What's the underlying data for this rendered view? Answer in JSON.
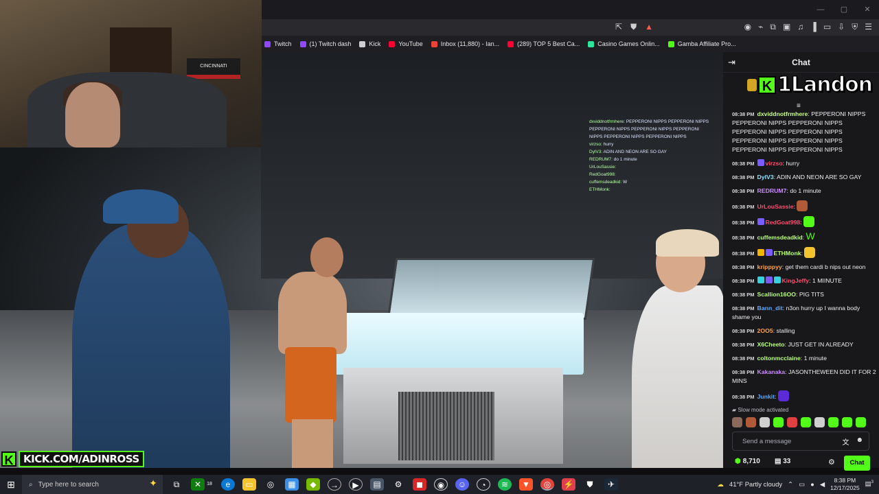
{
  "browser": {
    "bookmarks": [
      {
        "label": "Twitch",
        "color": "#9146ff"
      },
      {
        "label": "(1) Twitch dash",
        "color": "#9146ff"
      },
      {
        "label": "Kick",
        "color": "#cfcfcf"
      },
      {
        "label": "YouTube",
        "color": "#ff0033"
      },
      {
        "label": "Inbox (11,880) - Ian...",
        "color": "#ea4335"
      },
      {
        "label": "(289) TOP 5 Best Ca...",
        "color": "#ff0033"
      },
      {
        "label": "Casino Games Onlin...",
        "color": "#2ee59d"
      },
      {
        "label": "Gamba Affiliate Pro...",
        "color": "#53fc18"
      }
    ]
  },
  "stream": {
    "kick_url": "KICK.COM/ADINROSS",
    "webcam_flag": "CINCINNATI",
    "overlay_chat": [
      {
        "user": "dxviddnotfrmhere:",
        "text": "PEPPERONI NIPPS PEPPERONI NIPPS"
      },
      {
        "user": "",
        "text": "PEPPERONI NIPPS PEPPERONI NIPPS PEPPERONI"
      },
      {
        "user": "",
        "text": "NIPPS PEPPERONI NIPPS PEPPERONI NIPPS"
      },
      {
        "user": "virzso:",
        "text": "hurry"
      },
      {
        "user": "DylV3:",
        "text": "ADIN AND NEON ARE SO GAY"
      },
      {
        "user": "REDRUM7:",
        "text": "do 1 minute"
      },
      {
        "user": "UrLouSassie:",
        "text": ""
      },
      {
        "user": "RedGoat998:",
        "text": ""
      },
      {
        "user": "cuffemsdeadkid:",
        "text": "W"
      },
      {
        "user": "ETHMonk:",
        "text": ""
      }
    ]
  },
  "chat": {
    "title": "Chat",
    "pinned_banner": "1Landon",
    "messages": [
      {
        "time": "08:38 PM",
        "user": "dxviddnotfrmhere",
        "color": "#c9ff8a",
        "text": "PEPPERONI NIPPS PEPPERONI NIPPS PEPPERONI NIPPS PEPPERONI NIPPS PEPPERONI NIPPS PEPPERONI NIPPS PEPPERONI NIPPS PEPPERONI NIPPS PEPPERONI NIPPS",
        "badges": []
      },
      {
        "time": "08:38 PM",
        "user": "virzso",
        "color": "#ff4d6d",
        "text": "hurry",
        "badges": [
          "#7b5cff"
        ]
      },
      {
        "time": "08:38 PM",
        "user": "DylV3",
        "color": "#8fe3ff",
        "text": "ADIN AND NEON ARE SO GAY",
        "badges": []
      },
      {
        "time": "08:38 PM",
        "user": "REDRUM7",
        "color": "#c98bff",
        "text": "do 1 minute",
        "badges": []
      },
      {
        "time": "08:38 PM",
        "user": "UrLouSassie",
        "color": "#ff4d6d",
        "text": "",
        "badges": [],
        "emote": "#b05a3a"
      },
      {
        "time": "08:38 PM",
        "user": "RedGoat998",
        "color": "#ff4d6d",
        "text": "",
        "badges": [
          "#7b5cff"
        ],
        "emote": "#53fc18"
      },
      {
        "time": "08:38 PM",
        "user": "cuffemsdeadkid",
        "color": "#b9ff7a",
        "text": "W",
        "badges": []
      },
      {
        "time": "08:38 PM",
        "user": "ETHMonk",
        "color": "#b9ff7a",
        "text": "",
        "badges": [
          "#f4b400",
          "#7b5cff"
        ],
        "emote": "#f4c430"
      },
      {
        "time": "08:38 PM",
        "user": "kripppyy",
        "color": "#ffa24a",
        "text": "get them cardi b nips out neon",
        "badges": []
      },
      {
        "time": "08:38 PM",
        "user": "KingJeffy",
        "color": "#ff4d6d",
        "text": "1 MIINUTE",
        "badges": [
          "#36d1dc",
          "#7b5cff",
          "#36d1dc"
        ]
      },
      {
        "time": "08:38 PM",
        "user": "Scallion16OO",
        "color": "#b9ff7a",
        "text": "PIG TITS",
        "badges": []
      },
      {
        "time": "08:38 PM",
        "user": "Bann_dit",
        "color": "#5aa9ff",
        "text": "n3on hurry up I wanna body shame you",
        "badges": []
      },
      {
        "time": "08:38 PM",
        "user": "2OO5",
        "color": "#ffa24a",
        "text": "stalling",
        "badges": []
      },
      {
        "time": "08:38 PM",
        "user": "X6Cheeto",
        "color": "#b9ff7a",
        "text": "JUST GET IN ALREADY",
        "badges": []
      },
      {
        "time": "08:38 PM",
        "user": "coltonmcclaine",
        "color": "#b9ff7a",
        "text": "1 minute",
        "badges": []
      },
      {
        "time": "08:38 PM",
        "user": "Kakanaka",
        "color": "#c98bff",
        "text": "JASONTHEWEEN DID IT FOR 2 MINS",
        "badges": []
      },
      {
        "time": "08:38 PM",
        "user": "Junkit",
        "color": "#5aa9ff",
        "text": "",
        "badges": [],
        "emote": "#5a2bd6"
      }
    ],
    "slow_mode": "Slow mode activated",
    "quick_emotes": [
      "#8a6a5a",
      "#b05a3a",
      "#cfcfcf",
      "#53fc18",
      "#e04040",
      "#53fc18",
      "#cfcfcf",
      "#53fc18",
      "#53fc18",
      "#53fc18"
    ],
    "input_placeholder": "Send a message",
    "points": "8,710",
    "gift_count": "33",
    "chat_button": "Chat"
  },
  "taskbar": {
    "search_placeholder": "Type here to search",
    "xbox_badge": "18",
    "weather": "41°F  Partly cloudy",
    "time": "8:38 PM",
    "date": "12/17/2025",
    "notification_count": "3"
  }
}
